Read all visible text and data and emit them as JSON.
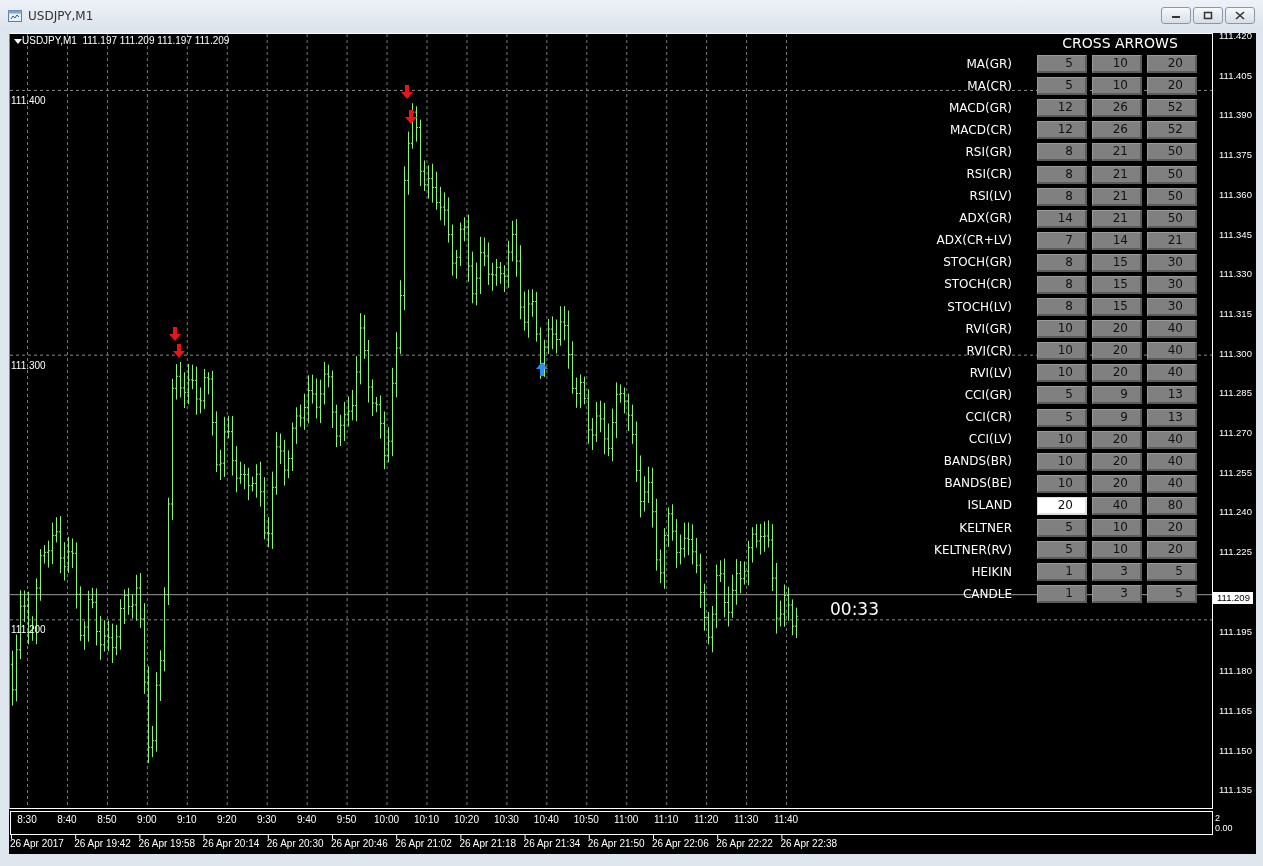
{
  "window": {
    "title": "USDJPY,M1"
  },
  "chart": {
    "header": "USDJPY,M1  111.197 111.209 111.197 111.209",
    "level_labels": [
      "111.400",
      "111.300",
      "111.200"
    ],
    "price_axis": [
      "111.420",
      "111.405",
      "111.390",
      "111.375",
      "111.360",
      "111.345",
      "111.330",
      "111.315",
      "111.300",
      "111.285",
      "111.270",
      "111.255",
      "111.240",
      "111.225",
      "111.195",
      "111.180",
      "111.165",
      "111.150",
      "111.135"
    ],
    "current_price": "111.209",
    "countdown": "00:33",
    "time_axis": [
      "8:30",
      "8:40",
      "8:50",
      "9:00",
      "9:10",
      "9:20",
      "9:30",
      "9:40",
      "9:50",
      "10:00",
      "10:10",
      "10:20",
      "10:30",
      "10:40",
      "10:50",
      "11:00",
      "11:10",
      "11:20",
      "11:30",
      "11:40"
    ],
    "date_axis": [
      "26 Apr 2017",
      "26 Apr 19:42",
      "26 Apr 19:58",
      "26 Apr 20:14",
      "26 Apr 20:30",
      "26 Apr 20:46",
      "26 Apr 21:02",
      "26 Apr 21:18",
      "26 Apr 21:34",
      "26 Apr 21:50",
      "26 Apr 22:06",
      "26 Apr 22:22",
      "26 Apr 22:38"
    ],
    "subwindow_scale": [
      "2",
      "0.00"
    ],
    "signals": [
      {
        "kind": "sell"
      },
      {
        "kind": "sell"
      },
      {
        "kind": "sell"
      },
      {
        "kind": "sell"
      },
      {
        "kind": "buy"
      }
    ]
  },
  "panel": {
    "title": "CROSS ARROWS",
    "rows": [
      {
        "label": "MA(GR)",
        "fields": [
          {
            "value": "5",
            "selected": false
          },
          {
            "value": "10",
            "selected": false
          },
          {
            "value": "20",
            "selected": false
          }
        ]
      },
      {
        "label": "MA(CR)",
        "fields": [
          {
            "value": "5",
            "selected": false
          },
          {
            "value": "10",
            "selected": false
          },
          {
            "value": "20",
            "selected": false
          }
        ]
      },
      {
        "label": "MACD(GR)",
        "fields": [
          {
            "value": "12",
            "selected": false
          },
          {
            "value": "26",
            "selected": false
          },
          {
            "value": "52",
            "selected": false
          }
        ]
      },
      {
        "label": "MACD(CR)",
        "fields": [
          {
            "value": "12",
            "selected": false
          },
          {
            "value": "26",
            "selected": false
          },
          {
            "value": "52",
            "selected": false
          }
        ]
      },
      {
        "label": "RSI(GR)",
        "fields": [
          {
            "value": "8",
            "selected": false
          },
          {
            "value": "21",
            "selected": false
          },
          {
            "value": "50",
            "selected": false
          }
        ]
      },
      {
        "label": "RSI(CR)",
        "fields": [
          {
            "value": "8",
            "selected": false
          },
          {
            "value": "21",
            "selected": false
          },
          {
            "value": "50",
            "selected": false
          }
        ]
      },
      {
        "label": "RSI(LV)",
        "fields": [
          {
            "value": "8",
            "selected": false
          },
          {
            "value": "21",
            "selected": false
          },
          {
            "value": "50",
            "selected": false
          }
        ]
      },
      {
        "label": "ADX(GR)",
        "fields": [
          {
            "value": "14",
            "selected": false
          },
          {
            "value": "21",
            "selected": false
          },
          {
            "value": "50",
            "selected": false
          }
        ]
      },
      {
        "label": "ADX(CR+LV)",
        "fields": [
          {
            "value": "7",
            "selected": false
          },
          {
            "value": "14",
            "selected": false
          },
          {
            "value": "21",
            "selected": false
          }
        ]
      },
      {
        "label": "STOCH(GR)",
        "fields": [
          {
            "value": "8",
            "selected": false
          },
          {
            "value": "15",
            "selected": false
          },
          {
            "value": "30",
            "selected": false
          }
        ]
      },
      {
        "label": "STOCH(CR)",
        "fields": [
          {
            "value": "8",
            "selected": false
          },
          {
            "value": "15",
            "selected": false
          },
          {
            "value": "30",
            "selected": false
          }
        ]
      },
      {
        "label": "STOCH(LV)",
        "fields": [
          {
            "value": "8",
            "selected": false
          },
          {
            "value": "15",
            "selected": false
          },
          {
            "value": "30",
            "selected": false
          }
        ]
      },
      {
        "label": "RVI(GR)",
        "fields": [
          {
            "value": "10",
            "selected": false
          },
          {
            "value": "20",
            "selected": false
          },
          {
            "value": "40",
            "selected": false
          }
        ]
      },
      {
        "label": "RVI(CR)",
        "fields": [
          {
            "value": "10",
            "selected": false
          },
          {
            "value": "20",
            "selected": false
          },
          {
            "value": "40",
            "selected": false
          }
        ]
      },
      {
        "label": "RVI(LV)",
        "fields": [
          {
            "value": "10",
            "selected": false
          },
          {
            "value": "20",
            "selected": false
          },
          {
            "value": "40",
            "selected": false
          }
        ]
      },
      {
        "label": "CCI(GR)",
        "fields": [
          {
            "value": "5",
            "selected": false
          },
          {
            "value": "9",
            "selected": false
          },
          {
            "value": "13",
            "selected": false
          }
        ]
      },
      {
        "label": "CCI(CR)",
        "fields": [
          {
            "value": "5",
            "selected": false
          },
          {
            "value": "9",
            "selected": false
          },
          {
            "value": "13",
            "selected": false
          }
        ]
      },
      {
        "label": "CCI(LV)",
        "fields": [
          {
            "value": "10",
            "selected": false
          },
          {
            "value": "20",
            "selected": false
          },
          {
            "value": "40",
            "selected": false
          }
        ]
      },
      {
        "label": "BANDS(BR)",
        "fields": [
          {
            "value": "10",
            "selected": false
          },
          {
            "value": "20",
            "selected": false
          },
          {
            "value": "40",
            "selected": false
          }
        ]
      },
      {
        "label": "BANDS(BE)",
        "fields": [
          {
            "value": "10",
            "selected": false
          },
          {
            "value": "20",
            "selected": false
          },
          {
            "value": "40",
            "selected": false
          }
        ]
      },
      {
        "label": "ISLAND",
        "fields": [
          {
            "value": "20",
            "selected": true
          },
          {
            "value": "40",
            "selected": false
          },
          {
            "value": "80",
            "selected": false
          }
        ]
      },
      {
        "label": "KELTNER",
        "fields": [
          {
            "value": "5",
            "selected": false
          },
          {
            "value": "10",
            "selected": false
          },
          {
            "value": "20",
            "selected": false
          }
        ]
      },
      {
        "label": "KELTNER(RV)",
        "fields": [
          {
            "value": "5",
            "selected": false
          },
          {
            "value": "10",
            "selected": false
          },
          {
            "value": "20",
            "selected": false
          }
        ]
      },
      {
        "label": "HEIKIN",
        "fields": [
          {
            "value": "1",
            "selected": false
          },
          {
            "value": "3",
            "selected": false
          },
          {
            "value": "5",
            "selected": false
          }
        ]
      },
      {
        "label": "CANDLE",
        "fields": [
          {
            "value": "1",
            "selected": false
          },
          {
            "value": "3",
            "selected": false
          },
          {
            "value": "5",
            "selected": false
          }
        ]
      }
    ]
  }
}
